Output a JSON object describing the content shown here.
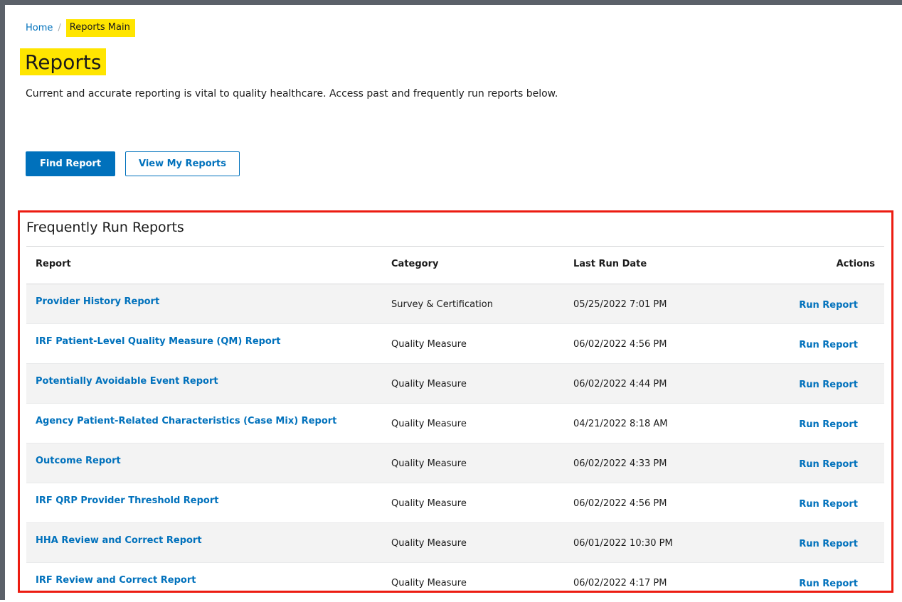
{
  "breadcrumb": {
    "home": "Home",
    "separator": "/",
    "current": "Reports Main"
  },
  "page": {
    "title": "Reports",
    "intro": "Current and accurate reporting is vital to quality healthcare. Access past and frequently run reports below."
  },
  "buttons": {
    "find_report": "Find Report",
    "view_my_reports": "View My Reports"
  },
  "panel": {
    "title": "Frequently Run Reports",
    "columns": {
      "report": "Report",
      "category": "Category",
      "last_run": "Last Run Date",
      "actions": "Actions"
    },
    "rows": [
      {
        "report": "Provider History Report",
        "category": "Survey & Certification",
        "last_run": "05/25/2022 7:01 PM",
        "action": "Run Report"
      },
      {
        "report": "IRF Patient-Level Quality Measure (QM) Report",
        "category": "Quality Measure",
        "last_run": "06/02/2022 4:56 PM",
        "action": "Run Report"
      },
      {
        "report": "Potentially Avoidable Event Report",
        "category": "Quality Measure",
        "last_run": "06/02/2022 4:44 PM",
        "action": "Run Report"
      },
      {
        "report": "Agency Patient-Related Characteristics (Case Mix) Report",
        "category": "Quality Measure",
        "last_run": "04/21/2022 8:18 AM",
        "action": "Run Report"
      },
      {
        "report": "Outcome Report",
        "category": "Quality Measure",
        "last_run": "06/02/2022 4:33 PM",
        "action": "Run Report"
      },
      {
        "report": "IRF QRP Provider Threshold Report",
        "category": "Quality Measure",
        "last_run": "06/02/2022 4:56 PM",
        "action": "Run Report"
      },
      {
        "report": "HHA Review and Correct Report",
        "category": "Quality Measure",
        "last_run": "06/01/2022 10:30 PM",
        "action": "Run Report"
      },
      {
        "report": "IRF Review and Correct Report",
        "category": "Quality Measure",
        "last_run": "06/02/2022 4:17 PM",
        "action": "Run Report"
      }
    ]
  },
  "colors": {
    "link": "#0071bc",
    "highlight": "#ffe500",
    "panel_border": "#ec1c11",
    "frame": "#5b6169"
  }
}
